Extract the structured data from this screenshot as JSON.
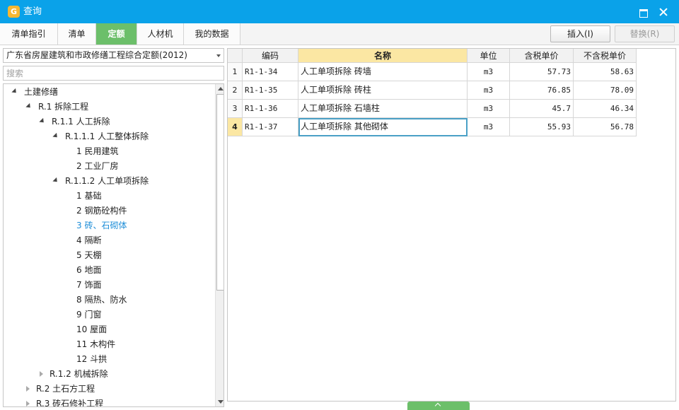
{
  "window": {
    "title": "查询",
    "app_icon": "app-logo-icon"
  },
  "tabs": [
    {
      "label": "清单指引",
      "active": false
    },
    {
      "label": "清单",
      "active": false
    },
    {
      "label": "定额",
      "active": true
    },
    {
      "label": "人材机",
      "active": false
    },
    {
      "label": "我的数据",
      "active": false
    }
  ],
  "actions": {
    "insert_label": "插入(I)",
    "replace_label": "替换(R)"
  },
  "left": {
    "standard_selected": "广东省房屋建筑和市政修缮工程综合定额(2012)",
    "search_placeholder": "搜索",
    "tree": [
      {
        "text": "土建修缮",
        "level": 0,
        "state": "expanded"
      },
      {
        "text": "R.1 拆除工程",
        "level": 1,
        "state": "expanded"
      },
      {
        "text": "R.1.1 人工拆除",
        "level": 2,
        "state": "expanded"
      },
      {
        "text": "R.1.1.1 人工整体拆除",
        "level": 3,
        "state": "expanded"
      },
      {
        "text": "1 民用建筑",
        "level": 4,
        "state": "leaf"
      },
      {
        "text": "2 工业厂房",
        "level": 4,
        "state": "leaf"
      },
      {
        "text": "R.1.1.2 人工单项拆除",
        "level": 3,
        "state": "expanded"
      },
      {
        "text": "1 基础",
        "level": 4,
        "state": "leaf"
      },
      {
        "text": "2 钢筋砼构件",
        "level": 4,
        "state": "leaf"
      },
      {
        "text": "3 砖、石砌体",
        "level": 4,
        "state": "leaf",
        "selected": true
      },
      {
        "text": "4 隔断",
        "level": 4,
        "state": "leaf"
      },
      {
        "text": "5 天棚",
        "level": 4,
        "state": "leaf"
      },
      {
        "text": "6 地面",
        "level": 4,
        "state": "leaf"
      },
      {
        "text": "7 饰面",
        "level": 4,
        "state": "leaf"
      },
      {
        "text": "8 隔热、防水",
        "level": 4,
        "state": "leaf"
      },
      {
        "text": "9 门窗",
        "level": 4,
        "state": "leaf"
      },
      {
        "text": "10 屋面",
        "level": 4,
        "state": "leaf"
      },
      {
        "text": "11 木构件",
        "level": 4,
        "state": "leaf"
      },
      {
        "text": "12 斗拱",
        "level": 4,
        "state": "leaf"
      },
      {
        "text": "R.1.2 机械拆除",
        "level": 2,
        "state": "collapsed"
      },
      {
        "text": "R.2 土石方工程",
        "level": 1,
        "state": "collapsed"
      },
      {
        "text": "R.3 砖石修补工程",
        "level": 1,
        "state": "collapsed"
      }
    ]
  },
  "grid": {
    "headers": {
      "code": "编码",
      "name": "名称",
      "unit": "单位",
      "tax_price": "含税单价",
      "notax_price": "不含税单价"
    },
    "rows": [
      {
        "index": "1",
        "code": "R1-1-34",
        "name": "人工单项拆除 砖墙",
        "unit": "m3",
        "tax_price": "57.73",
        "notax_price": "58.63"
      },
      {
        "index": "2",
        "code": "R1-1-35",
        "name": "人工单项拆除 砖柱",
        "unit": "m3",
        "tax_price": "76.85",
        "notax_price": "78.09"
      },
      {
        "index": "3",
        "code": "R1-1-36",
        "name": "人工单项拆除 石墙柱",
        "unit": "m3",
        "tax_price": "45.7",
        "notax_price": "46.34"
      },
      {
        "index": "4",
        "code": "R1-1-37",
        "name": "人工单项拆除 其他砌体",
        "unit": "m3",
        "tax_price": "55.93",
        "notax_price": "56.78",
        "current": true
      }
    ]
  }
}
